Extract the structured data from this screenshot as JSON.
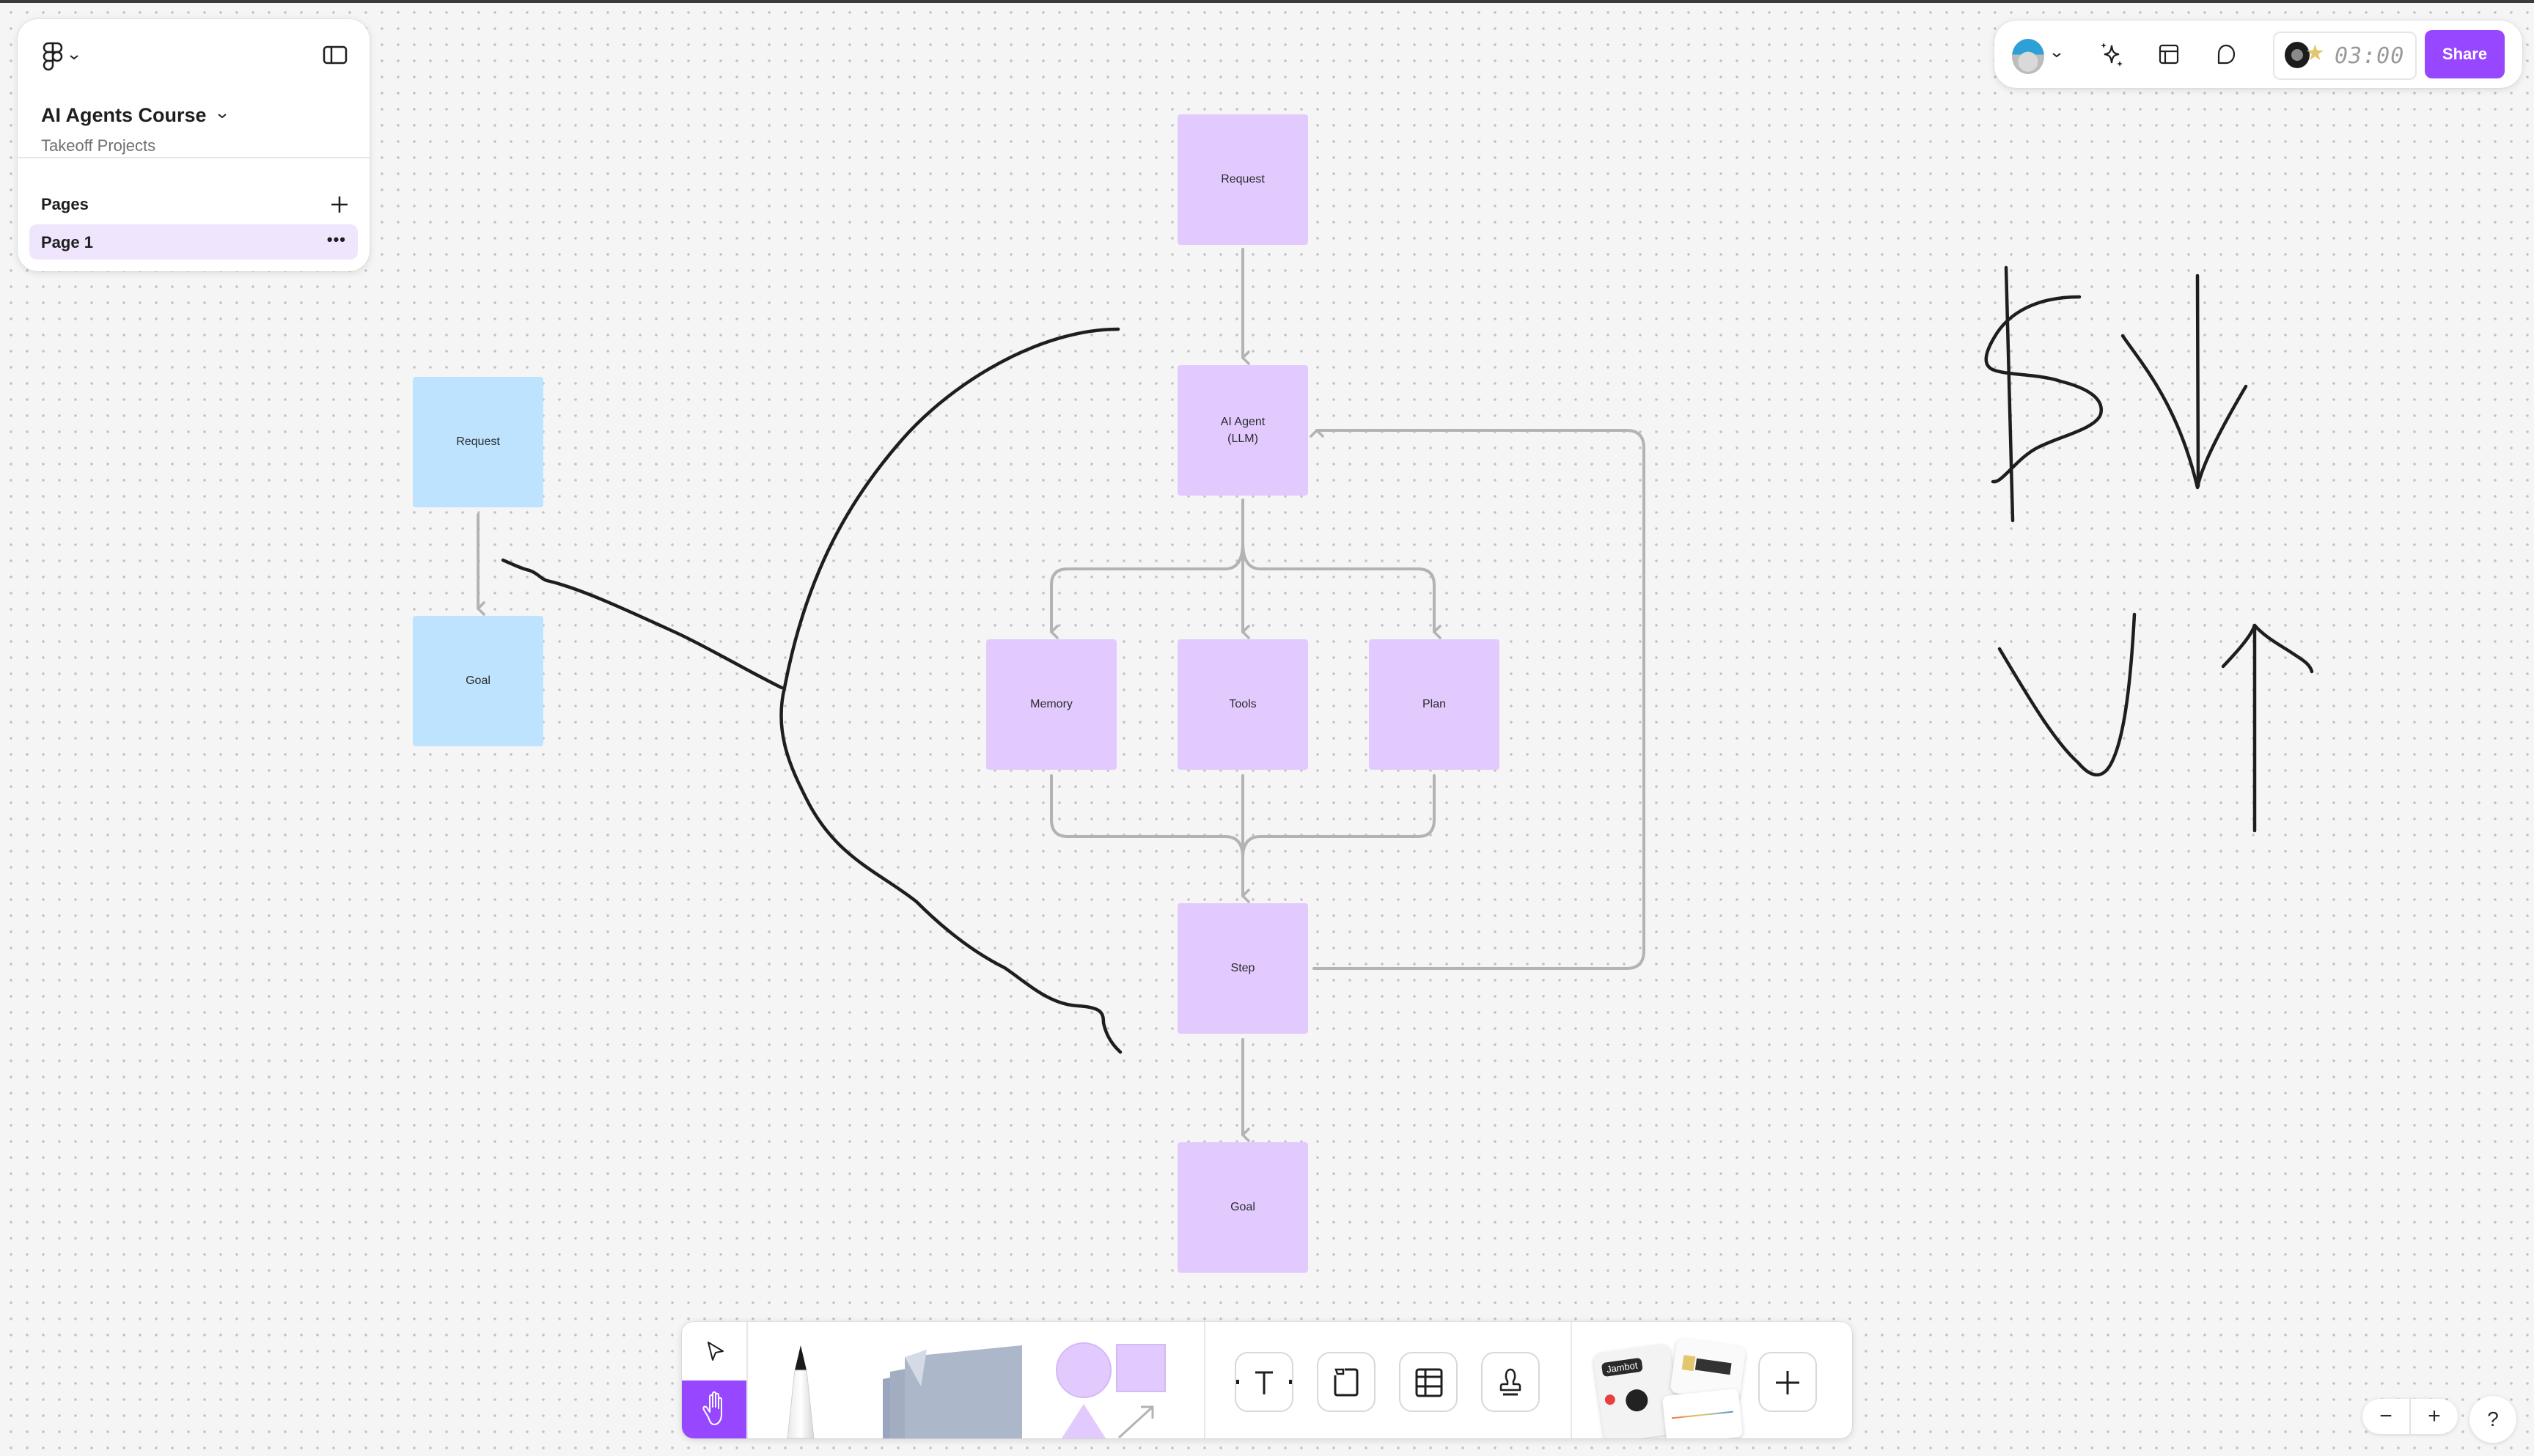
{
  "file": {
    "title": "AI Agents Course",
    "team": "Takeoff Projects"
  },
  "pages": {
    "heading": "Pages",
    "items": [
      {
        "label": "Page 1",
        "selected": true
      }
    ]
  },
  "toolbar_top": {
    "timer": "03:00",
    "share_label": "Share",
    "accent_color": "#9747ff"
  },
  "board": {
    "sticky_colors": {
      "purple": "#e2caff",
      "blue": "#bde3ff"
    },
    "flowchart": {
      "request": "Request",
      "agent": "AI Agent\n(LLM)",
      "memory": "Memory",
      "tools": "Tools",
      "plan": "Plan",
      "step": "Step",
      "goal": "Goal"
    },
    "mini_flow": {
      "request": "Request",
      "goal": "Goal"
    }
  },
  "toolbar_bottom": {
    "tools": [
      "move",
      "hand",
      "marker",
      "sticky-notes",
      "shapes",
      "text",
      "section",
      "table",
      "stamp",
      "templates",
      "more"
    ],
    "active_tool": "hand",
    "jambot_label": "Jambot"
  },
  "zoom_controls": {
    "zoom_out": "−",
    "zoom_in": "+",
    "help": "?"
  }
}
